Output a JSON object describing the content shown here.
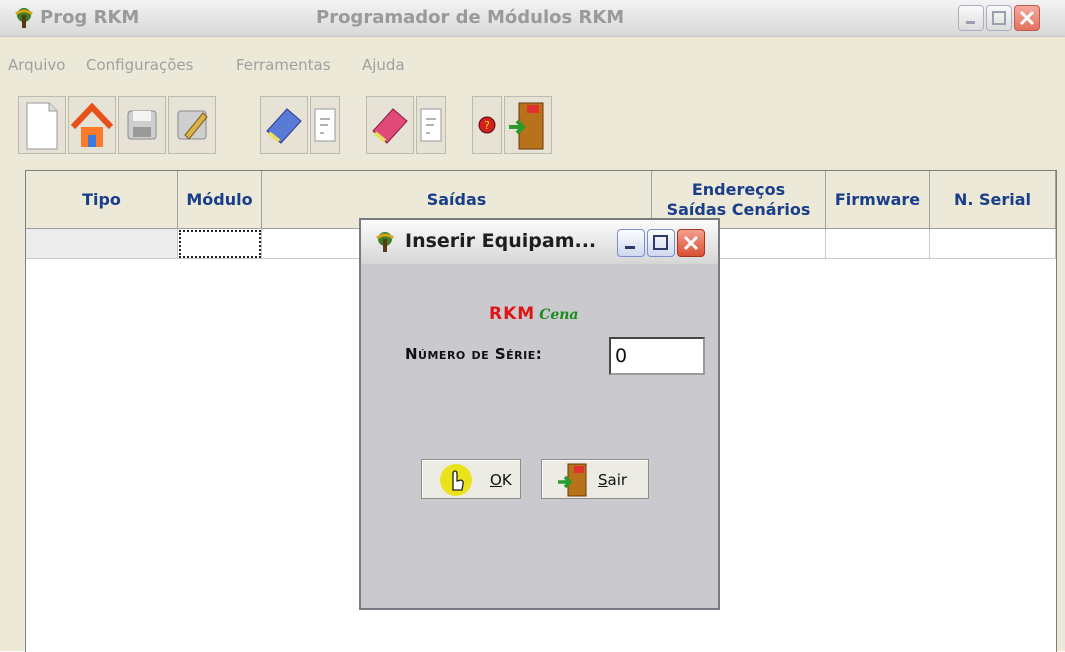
{
  "app": {
    "short_name": "Prog RKM",
    "window_title": "Programador de Módulos RKM"
  },
  "menu": [
    "Arquivo",
    "Configurações",
    "Ferramentas",
    "Ajuda"
  ],
  "toolbar": {
    "icons": [
      "new-document-icon",
      "home-icon",
      "save-icon",
      "edit-icon",
      "clean-module-icon",
      "document-icon",
      "clean-module-red-icon",
      "document-icon",
      "help-icon",
      "exit-door-icon"
    ]
  },
  "table": {
    "columns": [
      "Tipo",
      "Módulo",
      "Saídas",
      "Endereços Saídas Cenários",
      "Firmware",
      "N. Serial"
    ],
    "col_line1": "Endereços",
    "col_line2": "Saídas Cenários"
  },
  "dialog": {
    "title": "Inserir Equipam...",
    "logo_main": "RKM",
    "logo_sub": "Cena",
    "serial_label": "Número de Série:",
    "serial_value": "0",
    "ok_label_mnemonic": "O",
    "ok_label_rest": "K",
    "exit_label_mnemonic": "S",
    "exit_label_rest": "air"
  },
  "colors": {
    "header_text": "#1a3e8a",
    "logo_red": "#e01616",
    "logo_green": "#1a8a1a",
    "close_button": "#d94f33"
  }
}
